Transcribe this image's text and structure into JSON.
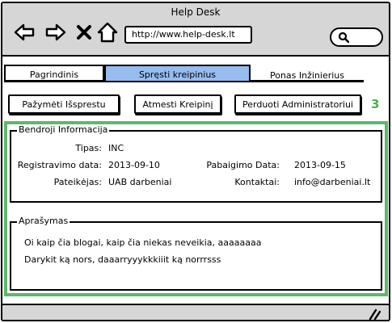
{
  "window": {
    "title": "Help Desk"
  },
  "browser": {
    "url": "http://www.help-desk.lt",
    "icons": [
      "back-arrow-icon",
      "forward-arrow-icon",
      "close-x-icon",
      "home-icon",
      "search-icon"
    ]
  },
  "tabs": [
    {
      "label": "Pagrindinis",
      "active": false
    },
    {
      "label": "Spręsti kreipinius",
      "active": true
    },
    {
      "label": "Ponas Inžinierius",
      "active": false
    }
  ],
  "actions": {
    "resolve": "Pažymėti Išsprestu",
    "reject": "Atmesti Kreipinį",
    "forward": "Perduoti Administratoriui",
    "marker": "3"
  },
  "colors": {
    "active_tab": "#96bcf0",
    "highlight": "#5cb96b",
    "chrome": "#d6d6d6"
  },
  "info": {
    "legend": "Bendroji Informacija",
    "type_label": "Tipas:",
    "type_value": "INC",
    "reg_label": "Registravimo data:",
    "reg_value": "2013-09-10",
    "end_label": "Pabaigimo Data:",
    "end_value": "2013-09-15",
    "submitter_label": "Pateikėjas:",
    "submitter_value": "UAB darbeniai",
    "contacts_label": "Kontaktai:",
    "contacts_value": "info@darbeniai.lt"
  },
  "description": {
    "legend": "Aprašymas",
    "lines": [
      "Oi kaip čia blogai, kaip čia niekas neveikia, aaaaaaaa",
      "Darykit ką nors, daaarryyykkkiiit ką norrrsss"
    ]
  }
}
